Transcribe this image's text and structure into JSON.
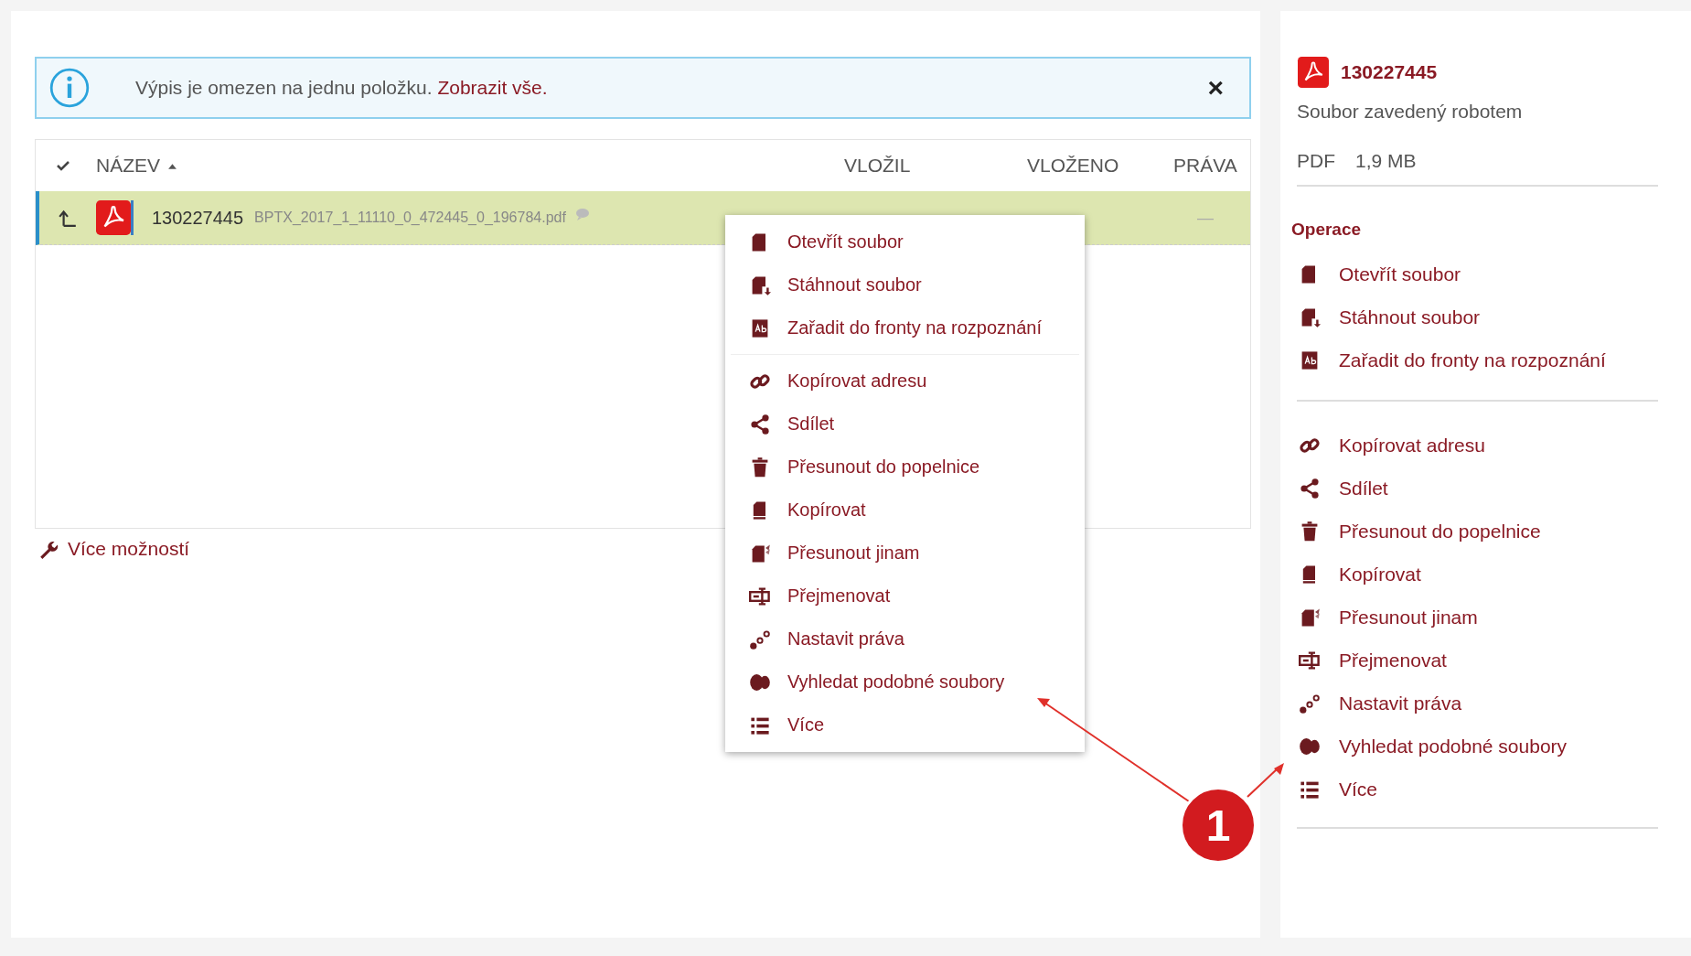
{
  "info_bar": {
    "message": "Výpis je omezen na jednu položku.",
    "link": "Zobrazit vše.",
    "close": "×"
  },
  "table": {
    "columns": [
      {
        "label": "NÁZEV",
        "sorted": true
      },
      {
        "label": "VLOŽIL",
        "sorted": false
      },
      {
        "label": "VLOŽENO",
        "sorted": false
      },
      {
        "label": "PRÁVA",
        "sorted": false
      }
    ],
    "rows": [
      {
        "selected": true,
        "name": "130227445",
        "filename": "BPTX_2017_1_11110_0_472445_0_196784.pdf",
        "rights": "—"
      }
    ]
  },
  "more_options": "Více možností",
  "context_menu": {
    "groups": [
      [
        {
          "kind": "open",
          "label": "Otevřít soubor"
        },
        {
          "kind": "download",
          "label": "Stáhnout soubor"
        },
        {
          "kind": "ocr",
          "label": "Zařadit do fronty na rozpoznání"
        }
      ],
      [
        {
          "kind": "link",
          "label": "Kopírovat adresu"
        },
        {
          "kind": "share",
          "label": "Sdílet"
        },
        {
          "kind": "trash",
          "label": "Přesunout do popelnice"
        },
        {
          "kind": "copy",
          "label": "Kopírovat"
        },
        {
          "kind": "move",
          "label": "Přesunout jinam"
        },
        {
          "kind": "rename",
          "label": "Přejmenovat"
        },
        {
          "kind": "rights",
          "label": "Nastavit práva"
        },
        {
          "kind": "similar",
          "label": "Vyhledat podobné soubory"
        },
        {
          "kind": "more",
          "label": "Více"
        }
      ]
    ]
  },
  "detail": {
    "title": "130227445",
    "subtitle": "Soubor zavedený robotem",
    "type": "PDF",
    "size": "1,9 MB",
    "section": "Operace",
    "groups": [
      [
        {
          "kind": "open",
          "label": "Otevřít soubor"
        },
        {
          "kind": "download",
          "label": "Stáhnout soubor"
        },
        {
          "kind": "ocr",
          "label": "Zařadit do fronty na rozpoznání"
        }
      ],
      [
        {
          "kind": "link",
          "label": "Kopírovat adresu"
        },
        {
          "kind": "share",
          "label": "Sdílet"
        },
        {
          "kind": "trash",
          "label": "Přesunout do popelnice"
        },
        {
          "kind": "copy",
          "label": "Kopírovat"
        },
        {
          "kind": "move",
          "label": "Přesunout jinam"
        },
        {
          "kind": "rename",
          "label": "Přejmenovat"
        },
        {
          "kind": "rights",
          "label": "Nastavit práva"
        },
        {
          "kind": "similar",
          "label": "Vyhledat podobné soubory"
        },
        {
          "kind": "more",
          "label": "Více"
        }
      ]
    ]
  },
  "callout": {
    "label": "1"
  }
}
